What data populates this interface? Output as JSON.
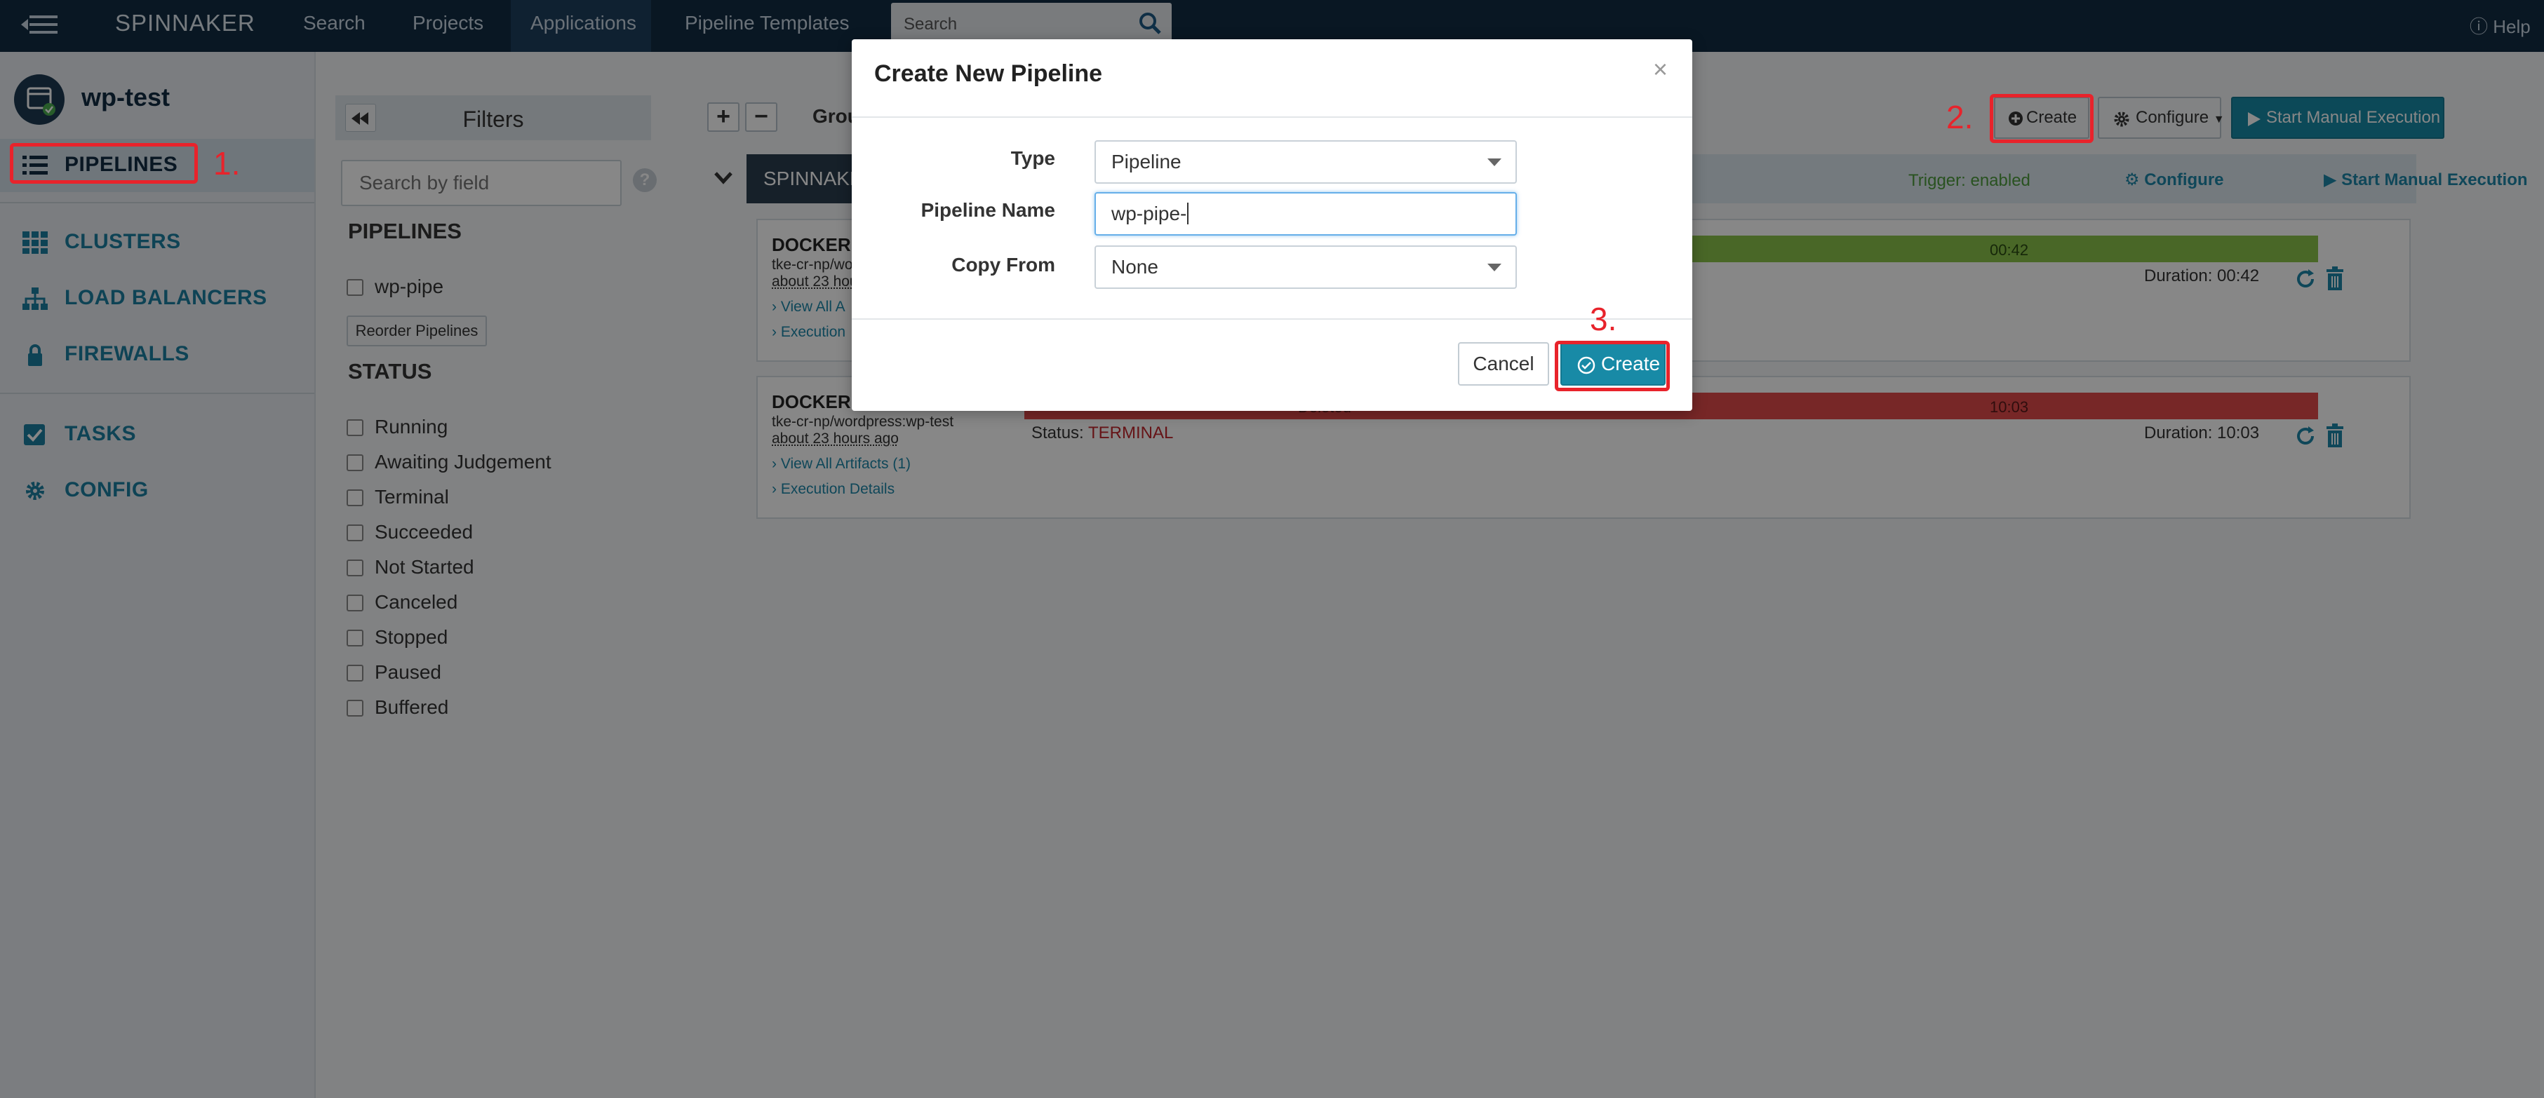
{
  "topnav": {
    "brand": "SPINNAKER",
    "items": [
      "Search",
      "Projects",
      "Applications",
      "Pipeline Templates"
    ],
    "search_placeholder": "Search",
    "help": "Help"
  },
  "sidebar": {
    "app_name": "wp-test",
    "items": [
      {
        "label": "PIPELINES",
        "icon": "list-icon"
      },
      {
        "label": "CLUSTERS",
        "icon": "grid-icon"
      },
      {
        "label": "LOAD BALANCERS",
        "icon": "sitemap-icon"
      },
      {
        "label": "FIREWALLS",
        "icon": "lock-icon"
      },
      {
        "label": "TASKS",
        "icon": "checkbox-icon"
      },
      {
        "label": "CONFIG",
        "icon": "gear-icon"
      }
    ]
  },
  "filters": {
    "title": "Filters",
    "search_placeholder": "Search by field",
    "pipelines_title": "PIPELINES",
    "pipelines": [
      "wp-pipe"
    ],
    "reorder_label": "Reorder Pipelines",
    "status_title": "STATUS",
    "statuses": [
      "Running",
      "Awaiting Judgement",
      "Terminal",
      "Succeeded",
      "Not Started",
      "Canceled",
      "Stopped",
      "Paused",
      "Buffered"
    ]
  },
  "main": {
    "group_label": "Grou",
    "create_label": "Create",
    "configure_label": "Configure",
    "start_label": "Start Manual Execution",
    "pipeline_name": "SPINNAKER",
    "trigger_text": "Trigger: enabled",
    "configure_link": "Configure",
    "start_link": "Start Manual Execution",
    "executions": [
      {
        "title": "DOCKER R",
        "sub": "tke-cr-np/wo",
        "age": "about 23 hou",
        "artifacts": "View All A",
        "details": "Execution",
        "bar_label": "00:42",
        "bar_fraction": 1.0,
        "duration": "Duration: 00:42",
        "status_label": "",
        "status_value": ""
      },
      {
        "title": "DOCKER R",
        "sub": "tke-cr-np/wordpress:wp-test",
        "age": "about 23 hours ago",
        "artifacts": "View All Artifacts (1)",
        "details": "Execution Details",
        "bar_label": "10:03",
        "bar_left_label": "Deleted",
        "duration": "Duration: 10:03",
        "status_label": "Status:",
        "status_value": "TERMINAL"
      }
    ]
  },
  "modal": {
    "title": "Create New Pipeline",
    "close": "×",
    "type_label": "Type",
    "type_value": "Pipeline",
    "name_label": "Pipeline Name",
    "name_value": "wp-pipe-",
    "copy_label": "Copy From",
    "copy_value": "None",
    "cancel": "Cancel",
    "create": "Create"
  },
  "annotations": [
    "1.",
    "2.",
    "3."
  ],
  "colors": {
    "nav_bg": "#122c43",
    "accent": "#188aa6",
    "success": "#8bc34a",
    "terminal": "#e04b4b",
    "highlight": "#e8232b"
  }
}
